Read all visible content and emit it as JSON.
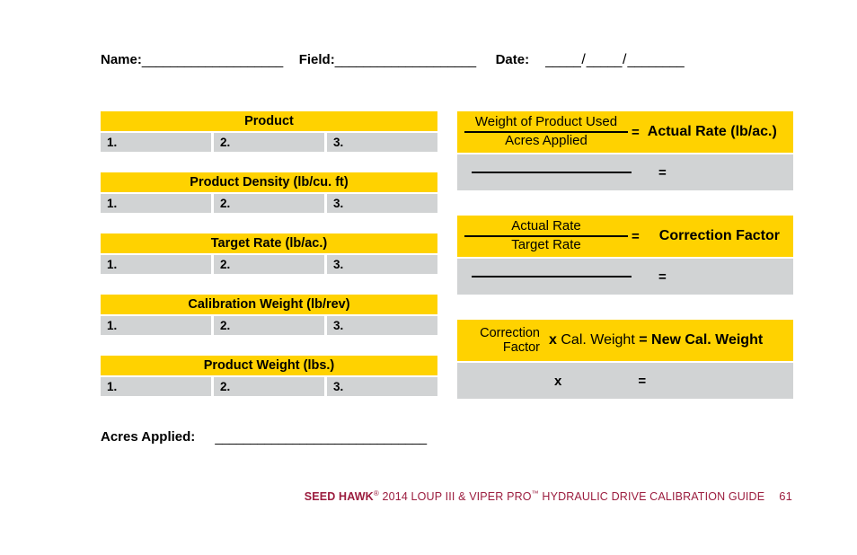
{
  "header": {
    "name_label": "Name:",
    "name_rule": "____________________",
    "field_label": "Field:",
    "field_rule": "____________________",
    "date_label": "Date:",
    "date_rule_month": "_____",
    "date_rule_day": "_____",
    "date_rule_year": "________",
    "date_separator": "/"
  },
  "tables": [
    {
      "title": "Product",
      "cells": [
        "1.",
        "2.",
        "3."
      ]
    },
    {
      "title": "Product Density (lb/cu. ft)",
      "cells": [
        "1.",
        "2.",
        "3."
      ]
    },
    {
      "title": "Target Rate (lb/ac.)",
      "cells": [
        "1.",
        "2.",
        "3."
      ]
    },
    {
      "title": "Calibration Weight (lb/rev)",
      "cells": [
        "1.",
        "2.",
        "3."
      ]
    },
    {
      "title": "Product Weight (lbs.)",
      "cells": [
        "1.",
        "2.",
        "3."
      ]
    }
  ],
  "acres": {
    "label": "Acres Applied:",
    "rule": "______________________________"
  },
  "formulas": [
    {
      "numerator": "Weight of Product Used",
      "denominator": "Acres Applied",
      "equals": "=",
      "result": "Actual Rate (lb/ac.)",
      "answer_equals": "="
    },
    {
      "numerator": "Actual Rate",
      "denominator": "Target Rate",
      "equals": "=",
      "result": "Correction Factor",
      "answer_equals": "="
    },
    {
      "factor_line1": "Correction",
      "factor_line2": "Factor",
      "multiply": "x",
      "operand": "Cal. Weight",
      "equals": "=",
      "result": "New Cal. Weight",
      "answer_multiply": "x",
      "answer_equals": "="
    }
  ],
  "footer": {
    "brand": "SEED HAWK",
    "registered": "®",
    "text": " 2014 LOUP III & VIPER PRO",
    "trademark": "™",
    "text2": " HYDRAULIC DRIVE CALIBRATION GUIDE",
    "page_number": "61"
  },
  "colors": {
    "accent_yellow": "#FFD200",
    "row_gray": "#D1D3D4",
    "footer_maroon": "#9B1C3E"
  }
}
